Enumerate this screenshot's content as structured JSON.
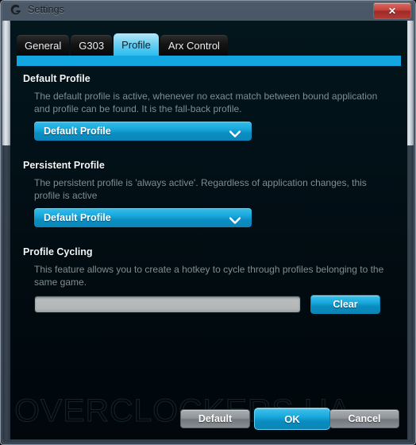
{
  "window": {
    "title": "Settings",
    "logo_icon": "logitech-g-icon",
    "close_label": "✕"
  },
  "tabs": [
    {
      "label": "General",
      "active": false
    },
    {
      "label": "G303",
      "active": false
    },
    {
      "label": "Profile",
      "active": true
    },
    {
      "label": "Arx Control",
      "active": false
    }
  ],
  "sections": [
    {
      "title": "Default Profile",
      "description": "The default profile is active, whenever no exact match between bound application and profile can be found. It is the fall-back profile.",
      "dropdown_value": "Default Profile"
    },
    {
      "title": "Persistent Profile",
      "description": "The persistent profile is 'always active'. Regardless of application changes, this profile is active",
      "dropdown_value": "Default Profile"
    },
    {
      "title": "Profile Cycling",
      "description": "This feature allows you to create a hotkey to cycle through profiles belonging to the same game.",
      "hotkey_value": "",
      "hotkey_placeholder": "",
      "clear_label": "Clear"
    }
  ],
  "footer": {
    "default_label": "Default",
    "ok_label": "OK",
    "cancel_label": "Cancel"
  },
  "watermark": {
    "text": "OVERCLOCKERS.UA"
  },
  "colors": {
    "accent_blue": "#12a7e0",
    "tab_active": "#29bdf0",
    "content_bg": "#021017",
    "titlebar": "#435060",
    "close_red": "#c4423c",
    "desc_text": "#7e8e93"
  }
}
